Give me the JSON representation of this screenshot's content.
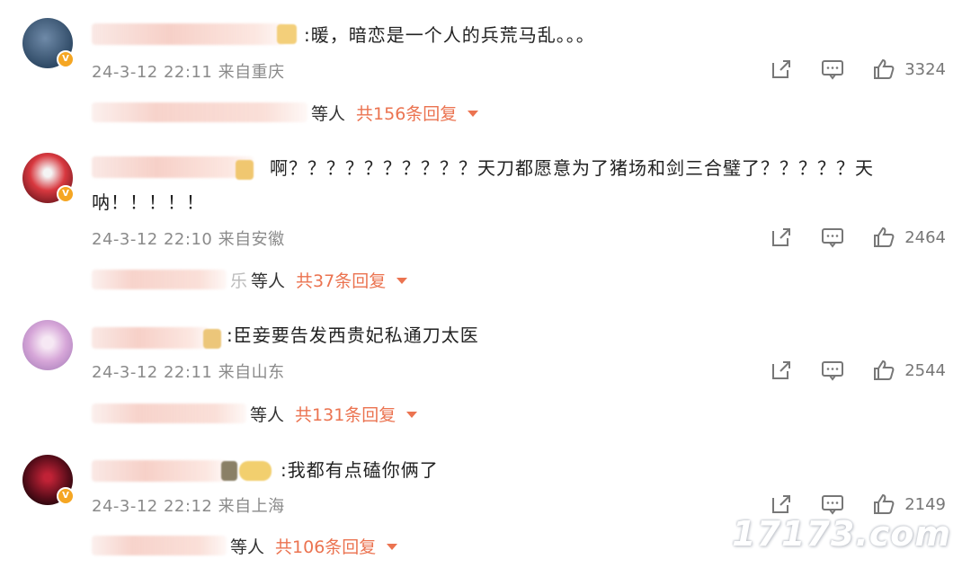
{
  "comments": [
    {
      "content_lines": [
        ":暖，暗恋是一个人的兵荒马乱。。。"
      ],
      "meta": "24-3-12 22:11 来自重庆",
      "likes": "3324",
      "reply_others": "等人",
      "reply_count": "共156条回复",
      "avatar_icon": "avatar-image"
    },
    {
      "content_lines": [
        "啊？？？？？？？？？？天刀都愿意为了猪场和剑三合璧了？？？？？天",
        "呐！！！！！"
      ],
      "meta": "24-3-12 22:10 来自安徽",
      "likes": "2464",
      "reply_tail": "乐",
      "reply_others": "等人",
      "reply_count": "共37条回复",
      "avatar_icon": "avatar-image"
    },
    {
      "content_lines": [
        ":臣妾要告发西贵妃私通刀太医"
      ],
      "meta": "24-3-12 22:11 来自山东",
      "likes": "2544",
      "reply_others": "等人",
      "reply_count": "共131条回复",
      "avatar_icon": "avatar-image"
    },
    {
      "content_lines": [
        ":我都有点磕你俩了"
      ],
      "meta": "24-3-12 22:12 来自上海",
      "likes": "2149",
      "reply_others": "等人",
      "reply_count": "共106条回复",
      "avatar_icon": "avatar-image"
    }
  ],
  "icons": {
    "share": "share-icon",
    "comment": "comment-icon",
    "like": "like-icon",
    "verified": "verified-badge-icon",
    "expand": "caret-down-icon"
  },
  "colors": {
    "accent": "#eb7350",
    "meta": "#8a8a8a",
    "verified": "#f5a623"
  },
  "watermark": "17173.com"
}
